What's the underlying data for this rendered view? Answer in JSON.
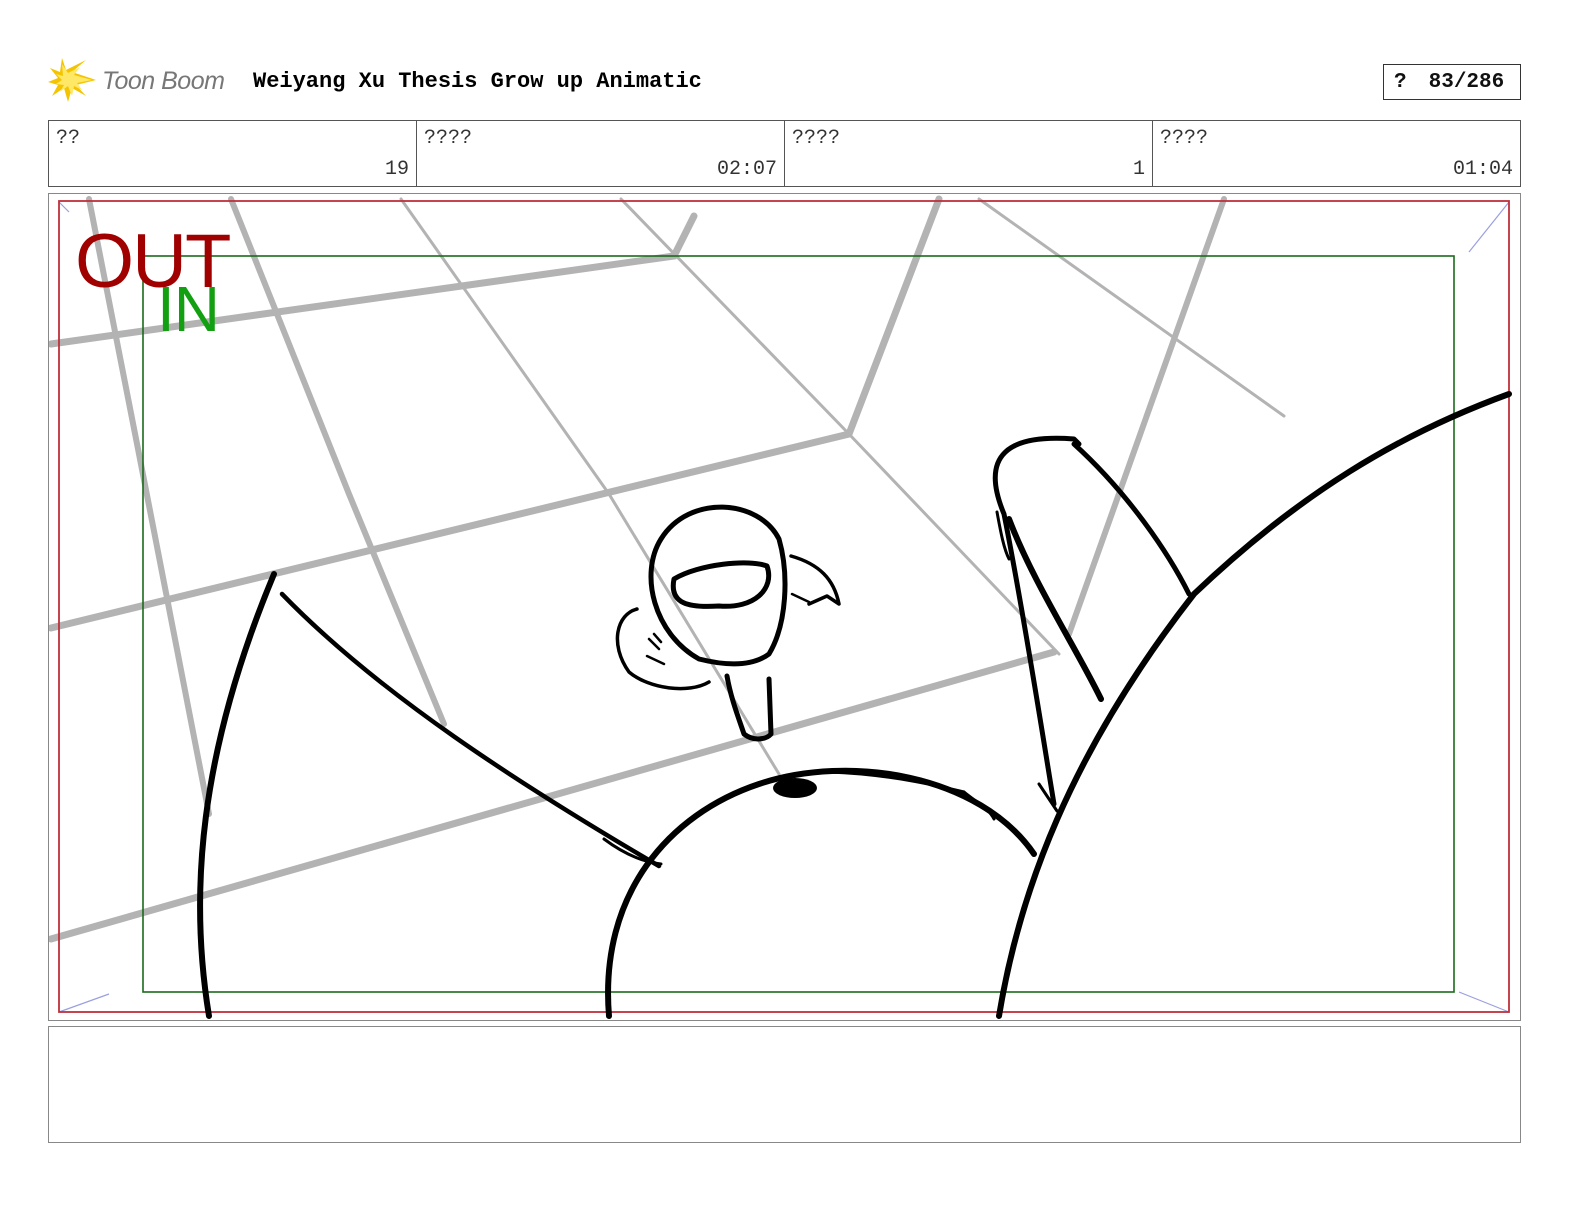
{
  "header": {
    "logo_text": "Toon Boom",
    "title": "Weiyang Xu Thesis Grow up Animatic",
    "page_marker": "?",
    "page_counter": "83/286"
  },
  "info": [
    {
      "label": "??",
      "value": "19"
    },
    {
      "label": "????",
      "value": "02:07"
    },
    {
      "label": "????",
      "value": "1"
    },
    {
      "label": "????",
      "value": "01:04"
    }
  ],
  "panel": {
    "out_label": "OUT",
    "in_label": "IN",
    "colors": {
      "out_frame": "#c0303a",
      "in_frame": "#1a6a1a",
      "grid_lines": "#b3b3b3",
      "ink": "#000000"
    }
  },
  "notes": {
    "text": ""
  }
}
